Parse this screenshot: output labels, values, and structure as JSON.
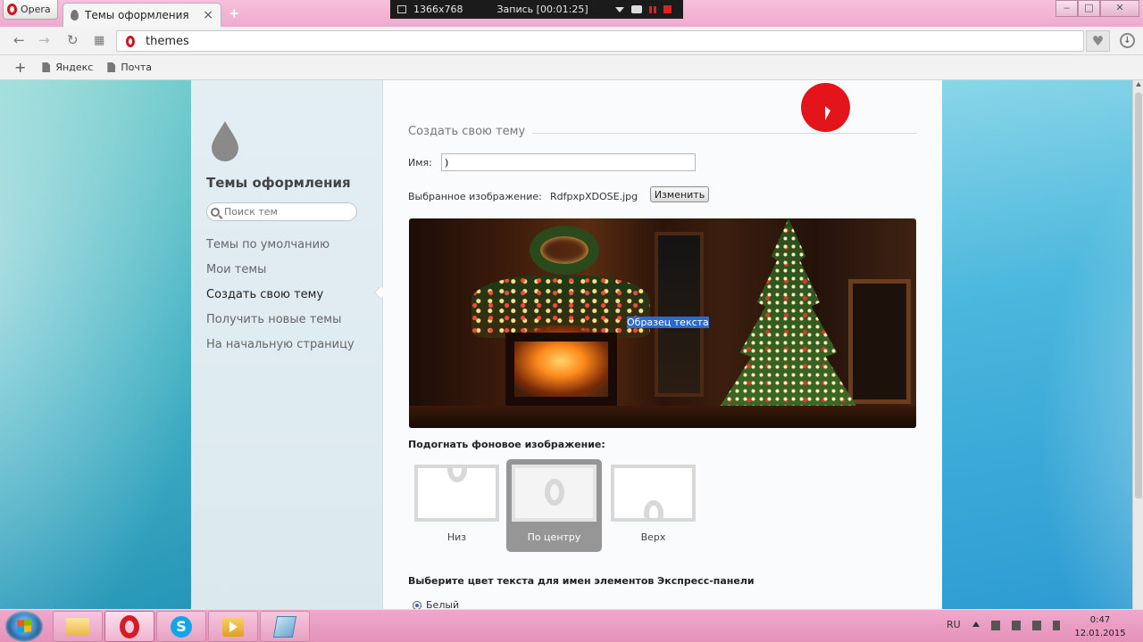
{
  "browser": {
    "menu_label": "Opera",
    "tab_title": "Темы оформления",
    "tab_close": "×",
    "new_tab": "+",
    "address": "themes",
    "bookmarks": [
      "Яндекс",
      "Почта"
    ],
    "bookmark_add": "+"
  },
  "recorder": {
    "resolution": "1366x768",
    "recording": "Запись [00:01:25]"
  },
  "window_controls": {
    "minimize": "‒",
    "maximize": "□",
    "close": "✕"
  },
  "sidebar": {
    "title": "Темы оформления",
    "search_placeholder": "Поиск тем",
    "items": [
      {
        "label": "Темы по умолчанию",
        "active": false
      },
      {
        "label": "Мои темы",
        "active": false
      },
      {
        "label": "Создать свою тему",
        "active": true
      },
      {
        "label": "Получить новые темы",
        "active": false
      },
      {
        "label": "На начальную страницу",
        "active": false
      }
    ]
  },
  "main": {
    "section_title": "Создать свою тему",
    "name_label": "Имя:",
    "name_value": ")",
    "image_label": "Выбранное изображение:",
    "image_file": "RdfpxpXDOSE.jpg",
    "change_button": "Изменить",
    "sample_text": "Образец текста",
    "fit_label": "Подогнать фоновое изображение:",
    "fit_options": [
      {
        "label": "Низ",
        "selected": false
      },
      {
        "label": "По центру",
        "selected": true
      },
      {
        "label": "Верх",
        "selected": false
      }
    ],
    "text_color_label": "Выберите цвет текста для имен элементов Экспресс-панели",
    "text_color_option": "Белый"
  },
  "taskbar": {
    "apps": [
      "explorer-folder-icon",
      "opera-icon",
      "skype-icon",
      "media-player-icon",
      "book-icon"
    ],
    "active_app": "opera-icon",
    "skype_letter": "S",
    "language": "RU",
    "time": "0:47",
    "date": "12.01.2015"
  },
  "colors": {
    "opera_red": "#d3131b",
    "taskbar_pink": "#e592bb",
    "selection_blue": "#2a6bd1",
    "cursor_highlight": "#e3151a"
  }
}
